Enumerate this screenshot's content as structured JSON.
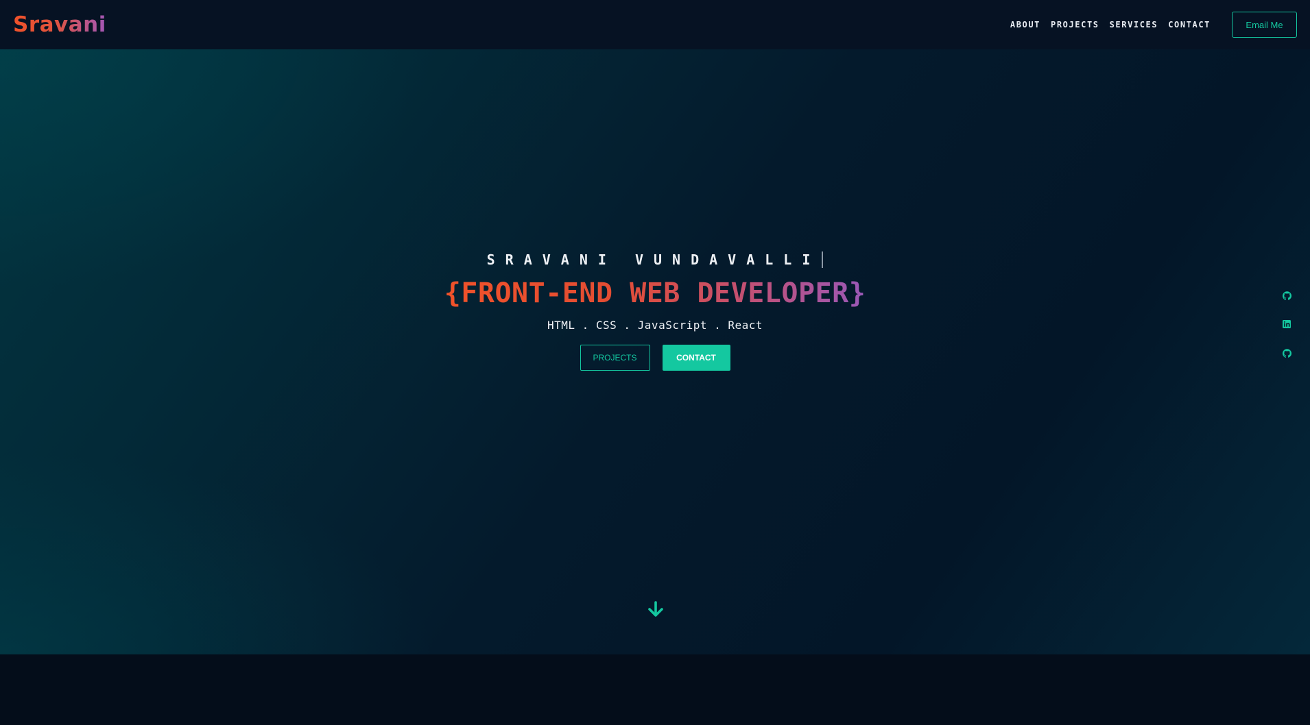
{
  "navbar": {
    "logo": "Sravani",
    "links": [
      "ABOUT",
      "PROJECTS",
      "SERVICES",
      "CONTACT"
    ],
    "email_button": "Email Me"
  },
  "hero": {
    "name": "SRAVANI VUNDAVALLI",
    "title": "{FRONT-END WEB DEVELOPER}",
    "skills": "HTML . CSS . JavaScript . React",
    "projects_button": "PROJECTS",
    "contact_button": "CONTACT",
    "scroll_icon": "arrow-down-icon"
  },
  "socials": {
    "icons": [
      "github-icon",
      "linkedin-icon",
      "github-alt-icon"
    ]
  },
  "colors": {
    "accent": "#14c8a0",
    "logo_gradient_start": "#f0522a",
    "logo_gradient_end": "#a257b8",
    "nav_background": "#061223",
    "page_background": "#040d1a"
  }
}
